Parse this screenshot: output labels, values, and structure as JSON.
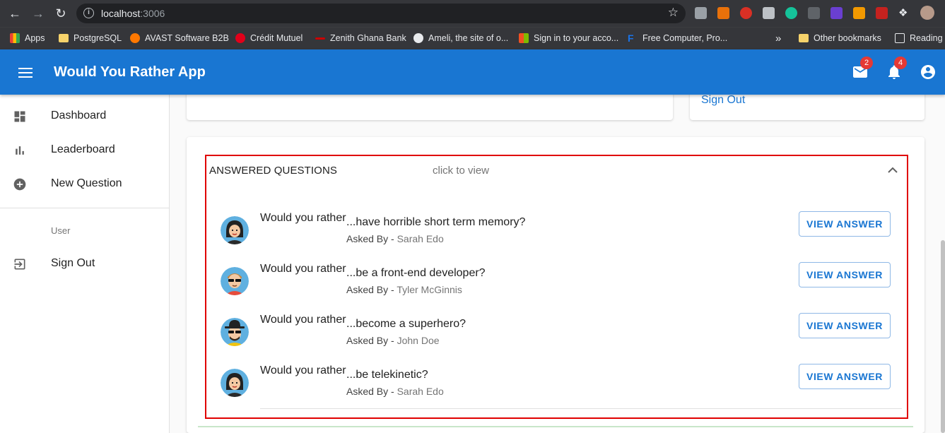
{
  "browser": {
    "url_host": "localhost",
    "url_port": ":3006",
    "bookmarks": [
      {
        "label": "Apps",
        "icon": "apps-grid-icon"
      },
      {
        "label": "PostgreSQL",
        "icon": "folder-icon"
      },
      {
        "label": "AVAST Software B2B",
        "icon": "avast-icon"
      },
      {
        "label": "Crédit Mutuel",
        "icon": "credit-mutuel-icon"
      },
      {
        "label": "Zenith Ghana Bank",
        "icon": "zenith-icon"
      },
      {
        "label": "Ameli, the site of o...",
        "icon": "ameli-icon"
      },
      {
        "label": "Sign in to your acco...",
        "icon": "microsoft-icon"
      },
      {
        "label": "Free Computer, Pro...",
        "icon": "f-icon"
      }
    ],
    "overflow_label": "»",
    "other_bookmarks": "Other bookmarks",
    "reading_list": "Reading"
  },
  "appbar": {
    "title": "Would You Rather App",
    "mail_badge": "2",
    "notification_badge": "4",
    "accent": "#1976d2"
  },
  "drawer": {
    "items": [
      {
        "label": "Dashboard",
        "icon": "dashboard-icon"
      },
      {
        "label": "Leaderboard",
        "icon": "bar-chart-icon"
      },
      {
        "label": "New Question",
        "icon": "add-circle-icon"
      }
    ],
    "subheader": "User",
    "signout": {
      "label": "Sign Out",
      "icon": "exit-icon"
    }
  },
  "profile_card": {
    "signout_link": "Sign Out"
  },
  "answered_panel": {
    "title": "ANSWERED QUESTIONS",
    "hint": "click to view",
    "prefix": "Would you rather",
    "asked_by_label": "Asked By - ",
    "button_label": "VIEW ANSWER",
    "questions": [
      {
        "text": "...have horrible short term memory?",
        "author": "Sarah Edo",
        "avatar": "female-avatar"
      },
      {
        "text": "...be a front-end developer?",
        "author": "Tyler McGinnis",
        "avatar": "male-sunglasses-avatar"
      },
      {
        "text": "...become a superhero?",
        "author": "John Doe",
        "avatar": "male-hat-avatar"
      },
      {
        "text": "...be telekinetic?",
        "author": "Sarah Edo",
        "avatar": "female-avatar"
      }
    ]
  }
}
